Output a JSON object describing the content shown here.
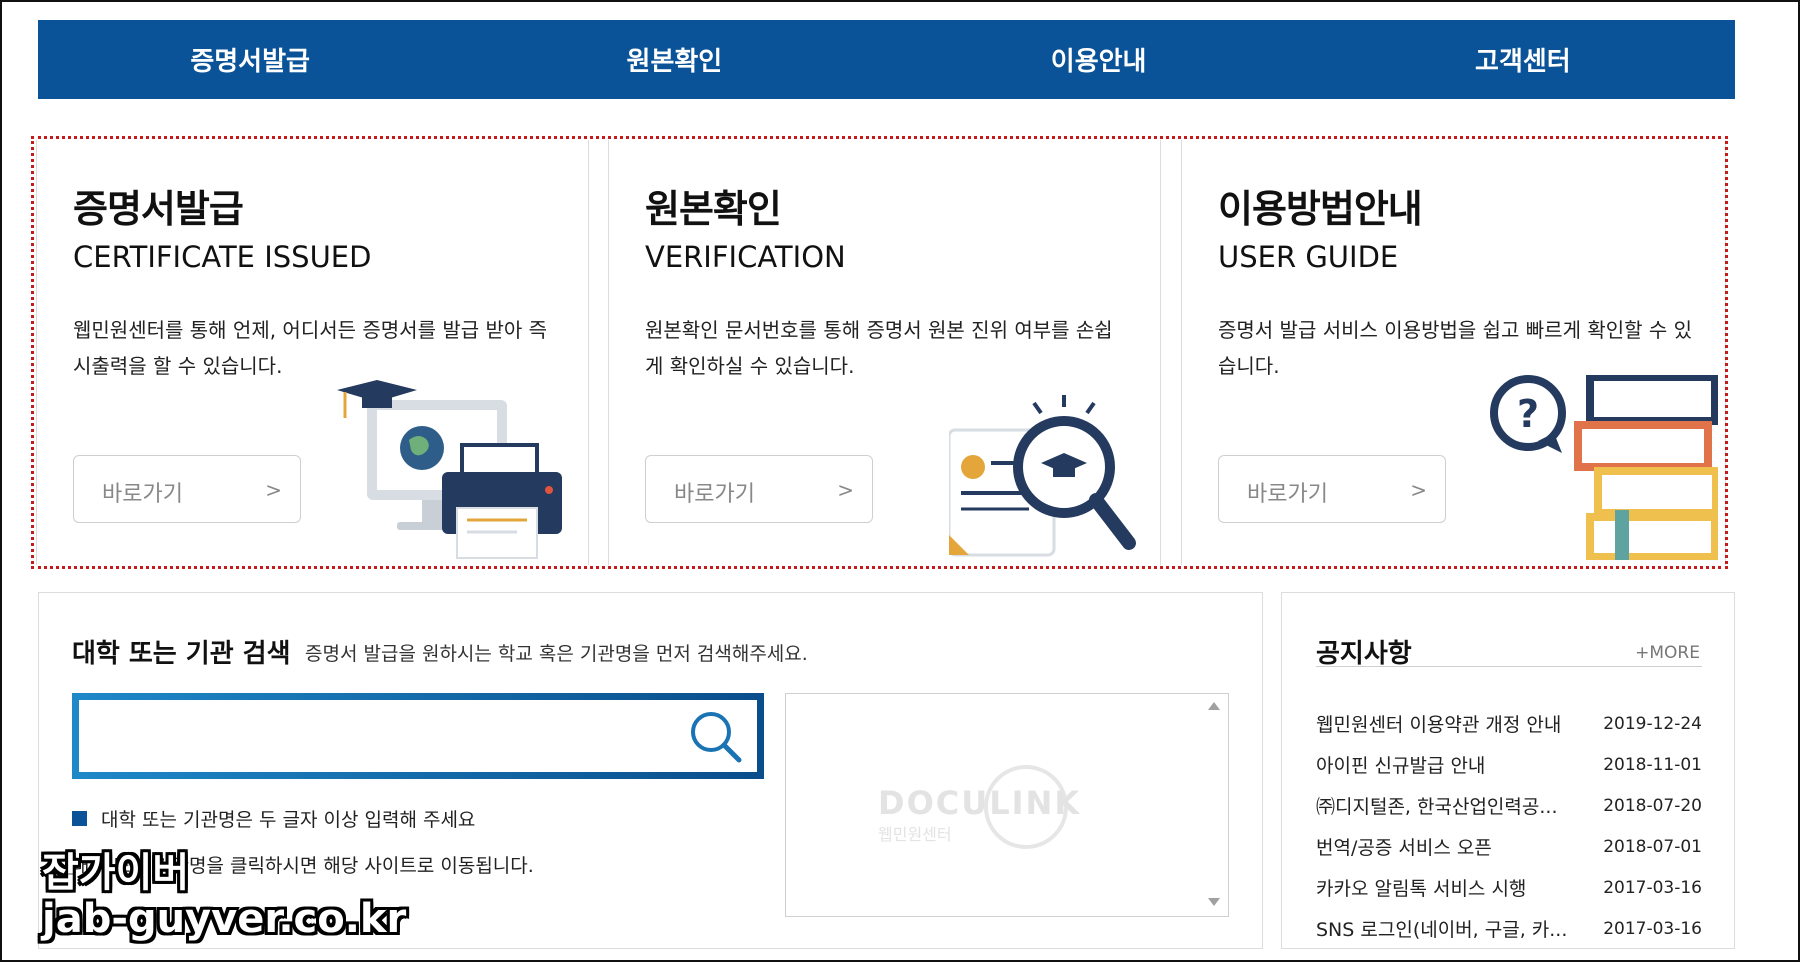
{
  "nav": {
    "items": [
      "증명서발급",
      "원본확인",
      "이용안내",
      "고객센터"
    ]
  },
  "cards": [
    {
      "title": "증명서발급",
      "subtitle": "CERTIFICATE ISSUED",
      "desc": "웹민원센터를 통해 언제, 어디서든 증명서를 발급 받아 즉시출력을 할 수 있습니다.",
      "button": "바로가기",
      "arrow": ">"
    },
    {
      "title": "원본확인",
      "subtitle": "VERIFICATION",
      "desc": "원본확인 문서번호를 통해 증명서 원본 진위 여부를 손쉽게 확인하실 수 있습니다.",
      "button": "바로가기",
      "arrow": ">"
    },
    {
      "title": "이용방법안내",
      "subtitle": "USER GUIDE",
      "desc": "증명서 발급 서비스 이용방법을 쉽고 빠르게 확인할 수 있습니다.",
      "button": "바로가기",
      "arrow": ">"
    }
  ],
  "search": {
    "title": "대학 또는 기관 검색",
    "hint": "증명서 발급을 원하시는 학교 혹은 기관명을 먼저 검색해주세요.",
    "value": "",
    "bullet1": "대학 또는 기관명은 두 글자 이상 입력해 주세요",
    "bullet2": "대학 또는 기관명을 클릭하시면 해당 사이트로 이동됩니다.",
    "logo_main": "DOCULINK",
    "logo_sub": "웹민원센터"
  },
  "notice": {
    "title": "공지사항",
    "more": "+MORE",
    "items": [
      {
        "text": "웹민원센터 이용약관 개정 안내",
        "date": "2019-12-24"
      },
      {
        "text": "아이핀 신규발급 안내",
        "date": "2018-11-01"
      },
      {
        "text": "㈜디지털존, 한국산업인력공...",
        "date": "2018-07-20"
      },
      {
        "text": "번역/공증 서비스 오픈",
        "date": "2018-07-01"
      },
      {
        "text": "카카오 알림톡 서비스 시행",
        "date": "2017-03-16"
      },
      {
        "text": "SNS 로그인(네이버, 구글, 카...",
        "date": "2017-03-16"
      }
    ]
  },
  "watermark": {
    "line1": "잡가이버",
    "line2": "jab-guyver.co.kr"
  },
  "colors": {
    "nav_bg": "#0a5398",
    "accent_red_dotted": "#c41a1a",
    "search_border": "#0c6dac"
  }
}
